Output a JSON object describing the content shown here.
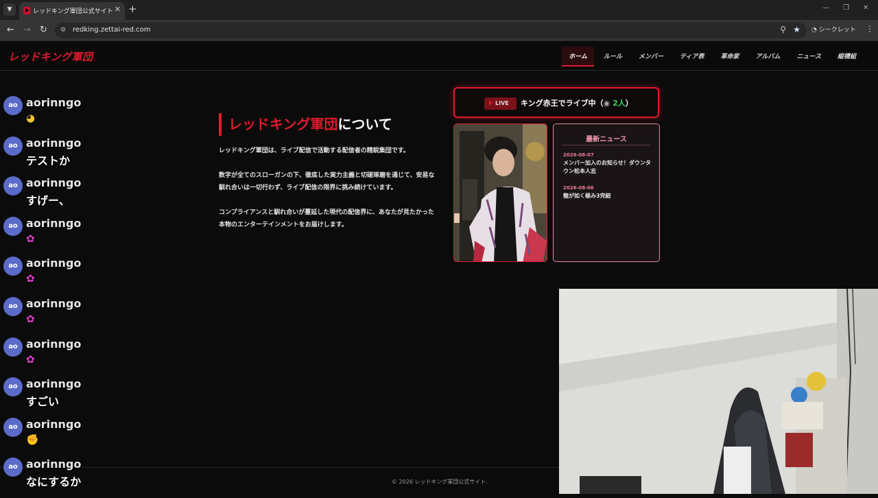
{
  "browser": {
    "tab_title": "レッドキング軍団公式サイト",
    "url": "redking.zettai-red.com",
    "incognito_label": "シークレット"
  },
  "site": {
    "logo": "レッドキング軍団",
    "nav": [
      "ホーム",
      "ルール",
      "メンバー",
      "ティア表",
      "革命家",
      "アルバム",
      "ニュース",
      "縦積組"
    ],
    "active_nav": "ホーム"
  },
  "about": {
    "title_red": "レッドキング軍団",
    "title_white": "について",
    "paragraphs": [
      "レッドキング軍団は、ライブ配信で活動する配信者の精鋭集団です。",
      "数字が全てのスローガンの下、徹底した実力主義と切磋琢磨を通じて、安易な馴れ合いは一切行わず、ライブ配信の限界に挑み続けています。",
      "コンプライアンスと馴れ合いが蔓延した現代の配信界に、あなたが見たかった本物のエンターテインメントをお届けします。"
    ]
  },
  "live": {
    "badge": "LIVE",
    "text": "キング赤王でライブ中（",
    "viewer_icon": "eye-icon",
    "viewers": "2人",
    "close_paren": "）"
  },
  "news": {
    "heading": "最新ニュース",
    "items": [
      {
        "date": "2026-08-07",
        "headline": "メンバー加入のお知らせ！ダウンタウン松本人志"
      },
      {
        "date": "2026-08-06",
        "headline": "龍が如く極み3完結"
      }
    ]
  },
  "footer": {
    "copyright": "© 2026 レッドキング軍団公式サイト."
  },
  "chat": {
    "messages": [
      {
        "avatar": "ao",
        "user": "aorinngo",
        "text": "",
        "emoji": "pacman-emoji"
      },
      {
        "avatar": "ao",
        "user": "aorinngo",
        "text": "テストか",
        "emoji": ""
      },
      {
        "avatar": "ao",
        "user": "aorinngo",
        "text": "すげー、",
        "emoji": ""
      },
      {
        "avatar": "ao",
        "user": "aorinngo",
        "text": "",
        "emoji": "butterfly-emoji"
      },
      {
        "avatar": "ao",
        "user": "aorinngo",
        "text": "",
        "emoji": "butterfly-emoji"
      },
      {
        "avatar": "ao",
        "user": "aorinngo",
        "text": "",
        "emoji": "butterfly-emoji"
      },
      {
        "avatar": "ao",
        "user": "aorinngo",
        "text": "",
        "emoji": "butterfly-emoji"
      },
      {
        "avatar": "ao",
        "user": "aorinngo",
        "text": "すごい",
        "emoji": ""
      },
      {
        "avatar": "ao",
        "user": "aorinngo",
        "text": "",
        "emoji": "fist-emoji"
      },
      {
        "avatar": "ao",
        "user": "aorinngo",
        "text": "なにするか",
        "emoji": ""
      }
    ]
  },
  "colors": {
    "brand_red": "#e01b2d",
    "news_pink": "#f49ab0",
    "viewer_green": "#33d46a",
    "avatar_blue": "#5b6bc9"
  }
}
